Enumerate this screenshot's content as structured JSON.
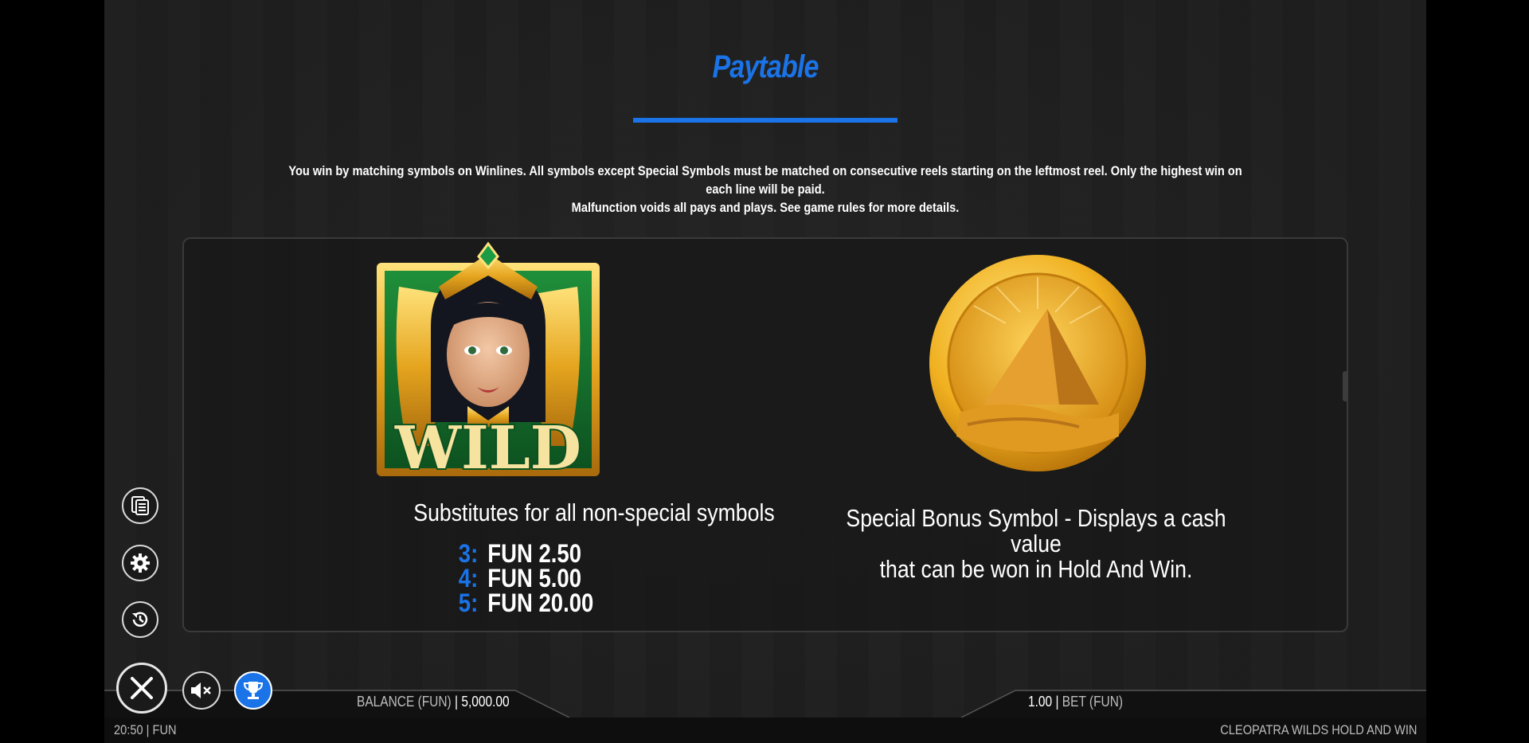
{
  "title": "Paytable",
  "intro": {
    "line1": "You win by matching symbols on Winlines. All symbols except Special Symbols must be matched on consecutive reels starting on the leftmost reel. Only the highest win on each line will be paid.",
    "line2": "Malfunction voids all pays and plays. See game rules for more details."
  },
  "symbols": [
    {
      "icon": "wild-cleopatra-icon",
      "logo_text": "WILD",
      "description": "Substitutes for all non-special symbols",
      "pays": [
        {
          "count": "3:",
          "value": "FUN 2.50"
        },
        {
          "count": "4:",
          "value": "FUN 5.00"
        },
        {
          "count": "5:",
          "value": "FUN 20.00"
        }
      ]
    },
    {
      "icon": "pyramid-coin-icon",
      "description_line1": "Special Bonus Symbol - Displays a cash value",
      "description_line2": "that can be won in Hold And Win."
    }
  ],
  "side_buttons": [
    "paytable-icon",
    "gear-icon",
    "history-icon"
  ],
  "footer": {
    "balance_label": "BALANCE (FUN)",
    "balance_value": "5,000.00",
    "bet_value": "1.00",
    "bet_label": "BET (FUN)",
    "separator": "|",
    "clock": "20:50 | FUN",
    "game_name": "CLEOPATRA WILDS HOLD AND WIN"
  },
  "colors": {
    "accent": "#1a74e8",
    "background": "#1e1e1e",
    "text": "#ffffff"
  }
}
